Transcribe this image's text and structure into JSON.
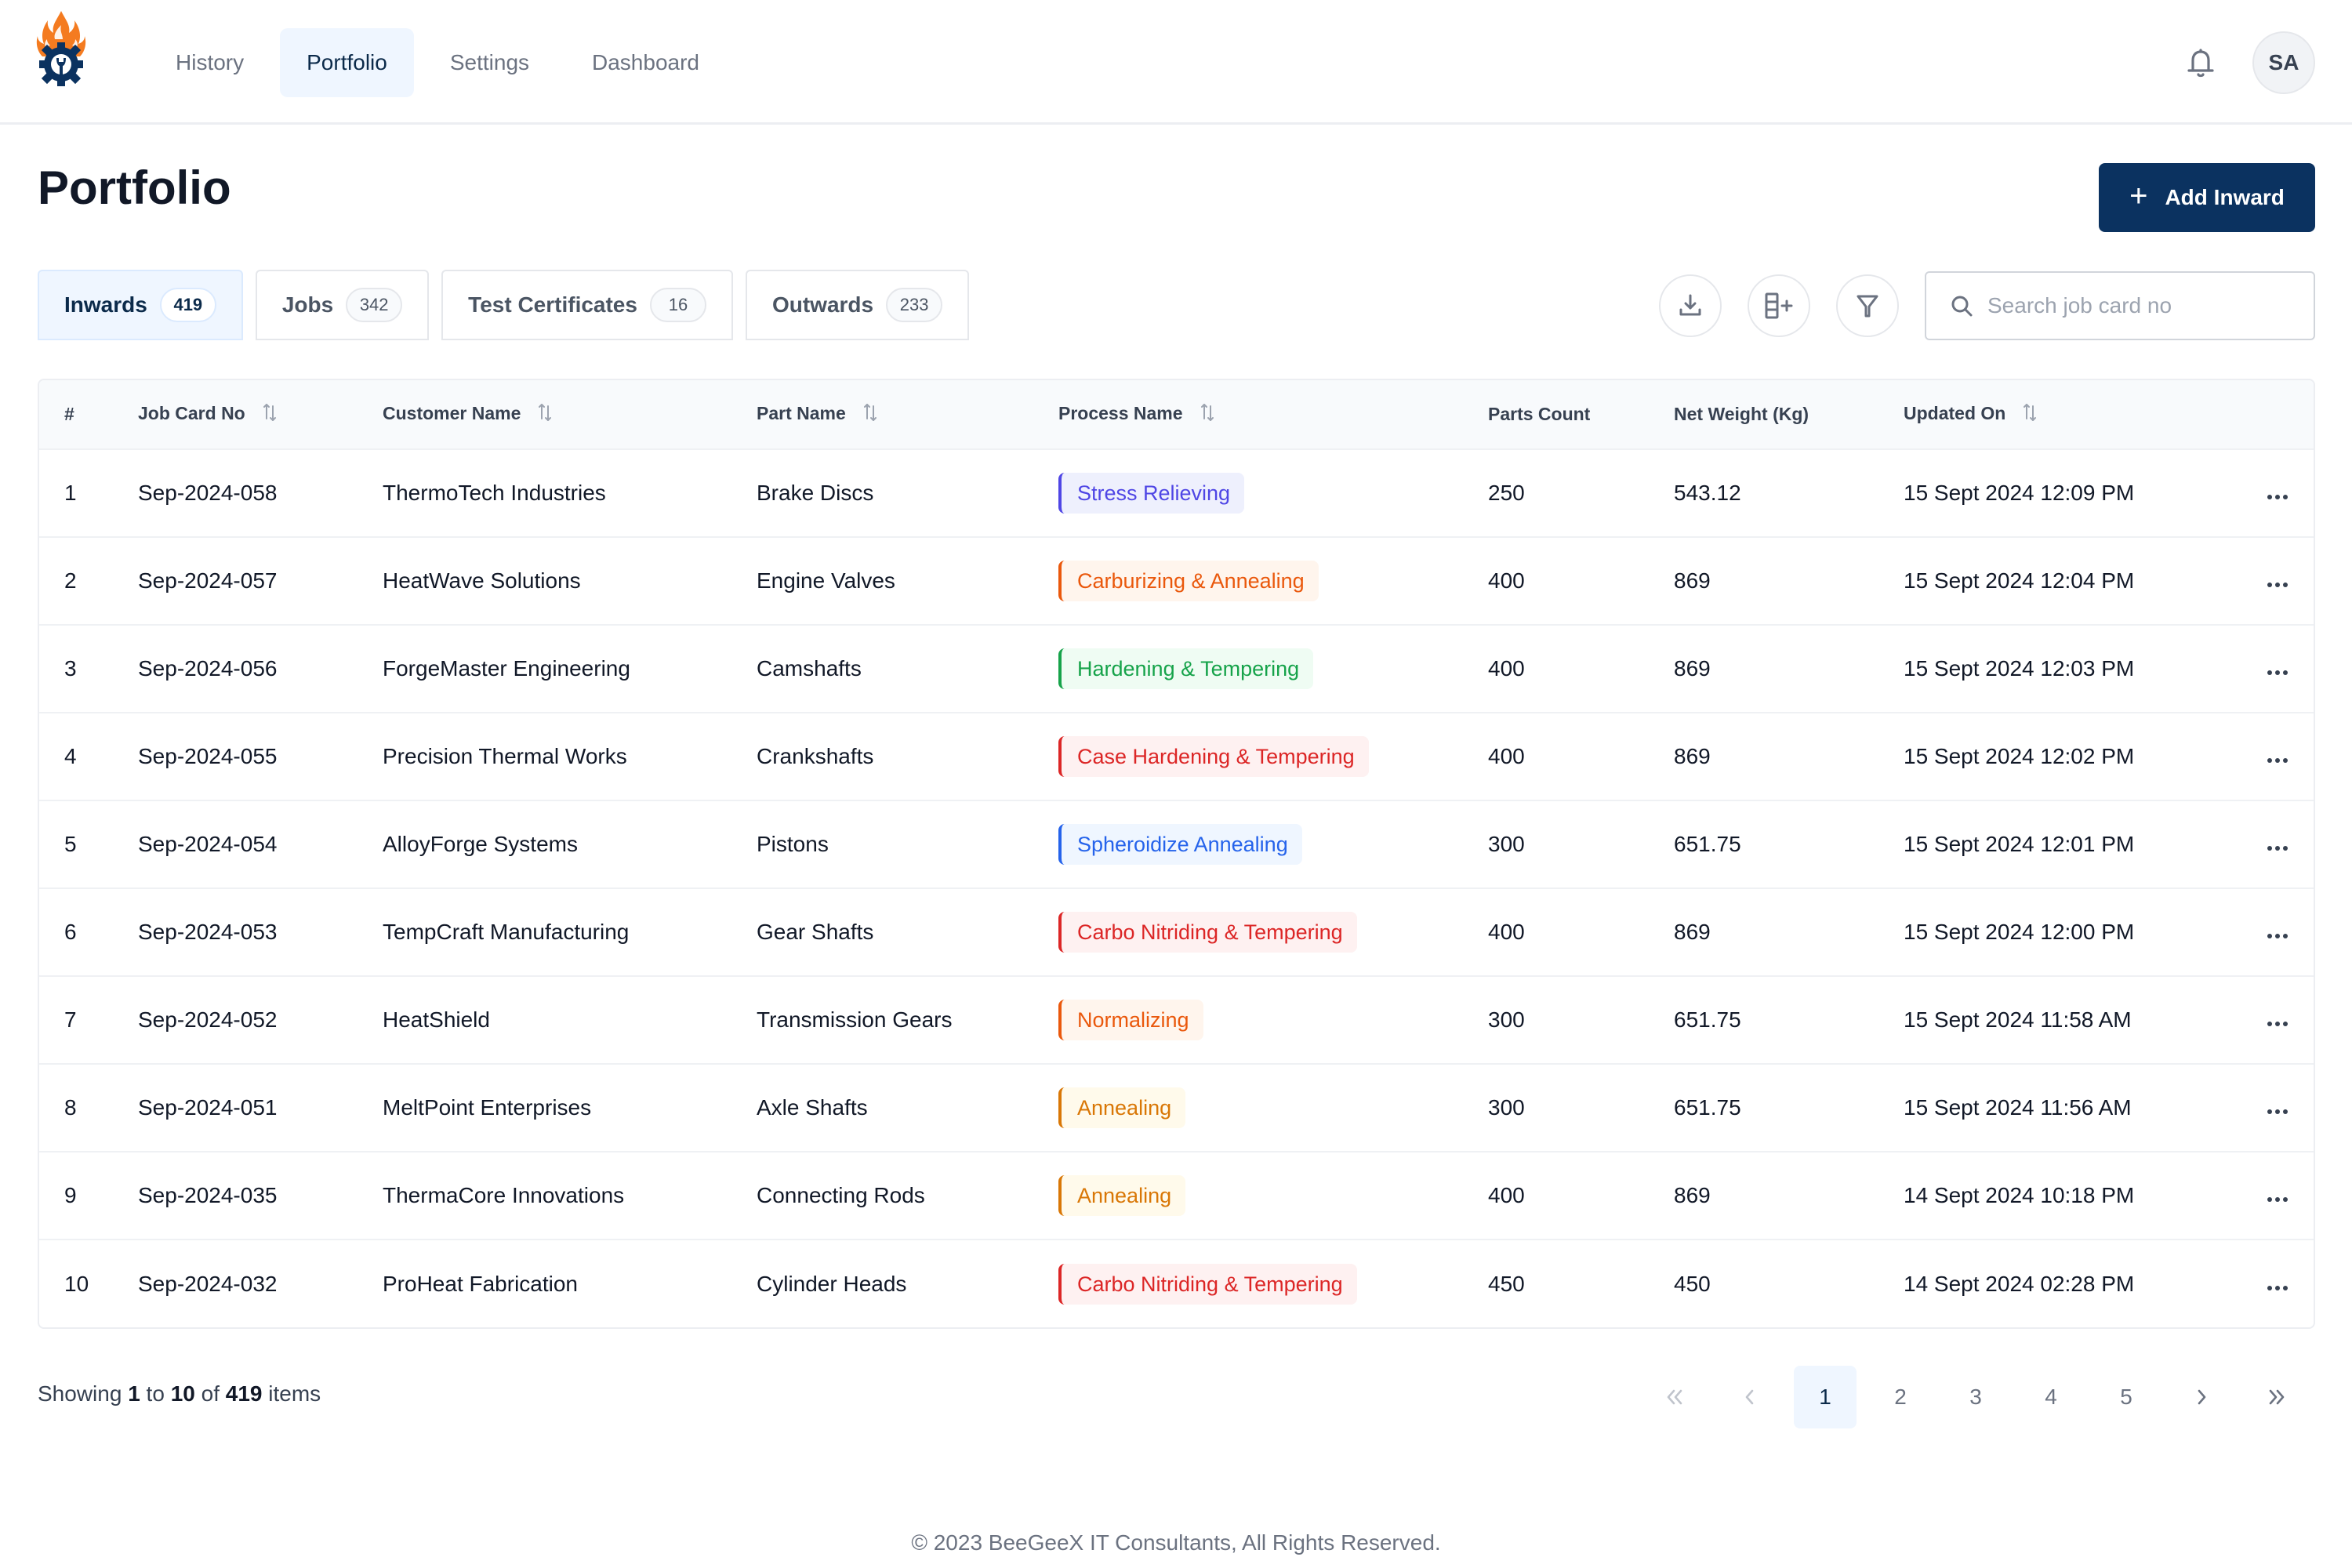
{
  "nav": {
    "items": [
      {
        "label": "History",
        "active": false
      },
      {
        "label": "Portfolio",
        "active": true
      },
      {
        "label": "Settings",
        "active": false
      },
      {
        "label": "Dashboard",
        "active": false
      }
    ],
    "avatar_initials": "SA",
    "icons": {
      "logo": "flame-gear-wrench-logo",
      "notifications": "bell-icon"
    }
  },
  "header": {
    "title": "Portfolio",
    "add_button_label": "Add Inward"
  },
  "tabs": [
    {
      "label": "Inwards",
      "count": "419",
      "active": true
    },
    {
      "label": "Jobs",
      "count": "342",
      "active": false
    },
    {
      "label": "Test Certificates",
      "count": "16",
      "active": false
    },
    {
      "label": "Outwards",
      "count": "233",
      "active": false
    }
  ],
  "toolbar": {
    "download_icon": "download-icon",
    "columns_icon": "add-column-icon",
    "filter_icon": "filter-icon",
    "search_placeholder": "Search job card no",
    "search_value": ""
  },
  "table": {
    "columns": [
      {
        "label": "#",
        "sortable": false
      },
      {
        "label": "Job Card No",
        "sortable": true
      },
      {
        "label": "Customer Name",
        "sortable": true
      },
      {
        "label": "Part Name",
        "sortable": true
      },
      {
        "label": "Process Name",
        "sortable": true
      },
      {
        "label": "Parts Count",
        "sortable": false
      },
      {
        "label": "Net Weight (Kg)",
        "sortable": false
      },
      {
        "label": "Updated On",
        "sortable": true
      },
      {
        "label": "",
        "sortable": false
      }
    ],
    "rows": [
      {
        "index": "1",
        "job_card": "Sep-2024-058",
        "customer": "ThermoTech Industries",
        "part": "Brake Discs",
        "process": "Stress Relieving",
        "process_color": "indigo",
        "parts_count": "250",
        "net_weight": "543.12",
        "updated_on": "15 Sept 2024 12:09 PM"
      },
      {
        "index": "2",
        "job_card": "Sep-2024-057",
        "customer": "HeatWave Solutions",
        "part": "Engine Valves",
        "process": "Carburizing & Annealing",
        "process_color": "orange",
        "parts_count": "400",
        "net_weight": "869",
        "updated_on": "15 Sept 2024 12:04 PM"
      },
      {
        "index": "3",
        "job_card": "Sep-2024-056",
        "customer": "ForgeMaster Engineering",
        "part": "Camshafts",
        "process": "Hardening & Tempering",
        "process_color": "green",
        "parts_count": "400",
        "net_weight": "869",
        "updated_on": "15 Sept 2024 12:03 PM"
      },
      {
        "index": "4",
        "job_card": "Sep-2024-055",
        "customer": "Precision Thermal Works",
        "part": "Crankshafts",
        "process": "Case Hardening & Tempering",
        "process_color": "red",
        "parts_count": "400",
        "net_weight": "869",
        "updated_on": "15 Sept 2024 12:02 PM"
      },
      {
        "index": "5",
        "job_card": "Sep-2024-054",
        "customer": "AlloyForge Systems",
        "part": "Pistons",
        "process": "Spheroidize Annealing",
        "process_color": "blue",
        "parts_count": "300",
        "net_weight": "651.75",
        "updated_on": "15 Sept 2024 12:01 PM"
      },
      {
        "index": "6",
        "job_card": "Sep-2024-053",
        "customer": "TempCraft Manufacturing",
        "part": "Gear Shafts",
        "process": "Carbo Nitriding & Tempering",
        "process_color": "red",
        "parts_count": "400",
        "net_weight": "869",
        "updated_on": "15 Sept 2024 12:00 PM"
      },
      {
        "index": "7",
        "job_card": "Sep-2024-052",
        "customer": "HeatShield",
        "part": "Transmission Gears",
        "process": "Normalizing",
        "process_color": "orange",
        "parts_count": "300",
        "net_weight": "651.75",
        "updated_on": "15 Sept 2024 11:58 AM"
      },
      {
        "index": "8",
        "job_card": "Sep-2024-051",
        "customer": "MeltPoint Enterprises",
        "part": "Axle Shafts",
        "process": "Annealing",
        "process_color": "amber",
        "parts_count": "300",
        "net_weight": "651.75",
        "updated_on": "15 Sept 2024 11:56 AM"
      },
      {
        "index": "9",
        "job_card": "Sep-2024-035",
        "customer": "ThermaCore Innovations",
        "part": "Connecting Rods",
        "process": "Annealing",
        "process_color": "amber",
        "parts_count": "400",
        "net_weight": "869",
        "updated_on": "14 Sept 2024 10:18 PM"
      },
      {
        "index": "10",
        "job_card": "Sep-2024-032",
        "customer": "ProHeat Fabrication",
        "part": "Cylinder Heads",
        "process": "Carbo Nitriding & Tempering",
        "process_color": "red",
        "parts_count": "450",
        "net_weight": "450",
        "updated_on": "14 Sept 2024 02:28 PM"
      }
    ],
    "row_action_icon": "more-horizontal-icon"
  },
  "badge_colors": {
    "indigo": {
      "text": "#4f46e5",
      "bg": "#eef0fd",
      "border": "#4f46e5"
    },
    "orange": {
      "text": "#ea580c",
      "bg": "#fff5ed",
      "border": "#ea580c"
    },
    "green": {
      "text": "#16a34a",
      "bg": "#effcf3",
      "border": "#16a34a"
    },
    "red": {
      "text": "#dc2626",
      "bg": "#fef1f1",
      "border": "#dc2626"
    },
    "blue": {
      "text": "#2563eb",
      "bg": "#eff6ff",
      "border": "#2563eb"
    },
    "amber": {
      "text": "#d97706",
      "bg": "#fffaeb",
      "border": "#d97706"
    }
  },
  "pagination": {
    "showing_prefix": "Showing",
    "from": "1",
    "to_word": "to",
    "to": "10",
    "of_word": "of",
    "total": "419",
    "suffix": "items",
    "pages": [
      "1",
      "2",
      "3",
      "4",
      "5"
    ],
    "current_page": "1",
    "first_icon": "chevrons-left-icon",
    "prev_icon": "chevron-left-icon",
    "next_icon": "chevron-right-icon",
    "last_icon": "chevrons-right-icon"
  },
  "footer": {
    "copyright": "© 2023 BeeGeeX IT Consultants, All Rights Reserved."
  },
  "theme": {
    "primary": "#0b3260",
    "active_bg": "#eff6ff",
    "logo_flame": "#f47b20",
    "logo_gear": "#0b3260"
  }
}
